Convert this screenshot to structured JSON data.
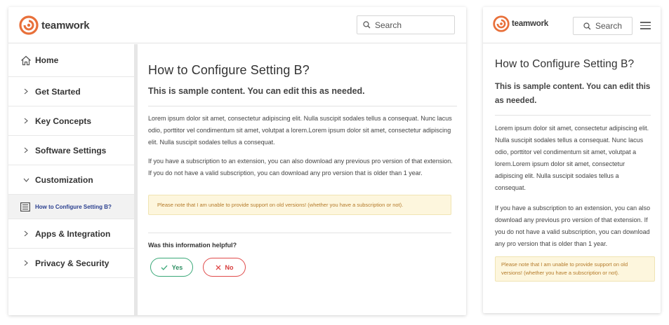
{
  "brand": {
    "name": "teamwork",
    "color": "#e8703a"
  },
  "search": {
    "label": "Search"
  },
  "sidebar": {
    "items": [
      {
        "label": "Home",
        "icon": "home-icon"
      },
      {
        "label": "Get Started",
        "icon": "chevron-right-icon"
      },
      {
        "label": "Key Concepts",
        "icon": "chevron-right-icon"
      },
      {
        "label": "Software Settings",
        "icon": "chevron-right-icon"
      },
      {
        "label": "Customization",
        "icon": "chevron-down-icon"
      },
      {
        "label": "How to Configure Setting B?",
        "icon": "document-icon",
        "active": true
      },
      {
        "label": "Apps & Integration",
        "icon": "chevron-right-icon"
      },
      {
        "label": "Privacy & Security",
        "icon": "chevron-right-icon"
      }
    ]
  },
  "article": {
    "title": "How to Configure Setting B?",
    "subtitle": "This is sample content. You can edit this as needed.",
    "paragraph1": "Lorem ipsum dolor sit amet, consectetur adipiscing elit. Nulla suscipit sodales tellus a consequat. Nunc lacus odio, porttitor vel condimentum sit amet, volutpat a lorem.Lorem ipsum dolor sit amet, consectetur adipiscing elit. Nulla suscipit sodales tellus a consequat.",
    "paragraph2": "If you have a subscription to an extension, you can also download any previous pro version of that extension. If you do not have a valid subscription, you can download any pro version that is older than 1 year.",
    "note": "Please note that I am unable to provide support on old versions! (whether you have a subscription or not)."
  },
  "feedback": {
    "question": "Was this information helpful?",
    "yes": "Yes",
    "no": "No",
    "yes_color": "#3aa878",
    "no_color": "#e04a4a"
  }
}
